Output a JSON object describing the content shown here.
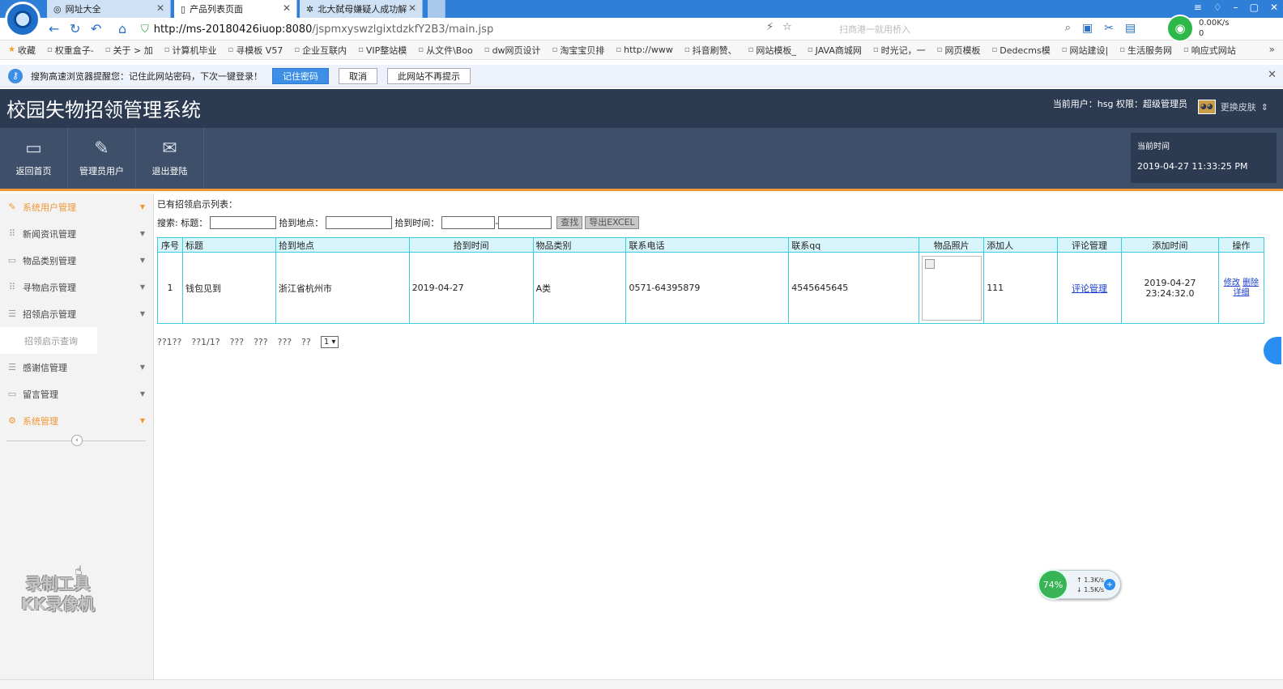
{
  "browser": {
    "tabs": [
      {
        "label": "网址大全",
        "active": false
      },
      {
        "label": "产品列表页面",
        "active": true
      },
      {
        "label": "北大弑母嫌疑人成功解",
        "active": false
      }
    ],
    "url_host": "http://ms-20180426iuop:8080",
    "url_path": "/jspmxyswzlgixtdzkfY2B3/main.jsp",
    "search_placeholder": "扫商港一就用桥入",
    "net_speed_down": "0.00K/s",
    "net_speed_up": "0",
    "bookmarks": [
      "收藏",
      "权重盒子-",
      "关于 > 加",
      "计算机毕业",
      "寻模板 V57",
      "企业互联内",
      "VIP整站模",
      "从文件\\Boo",
      "dw网页设计",
      "淘宝宝贝排",
      "http://www",
      "抖音刷赞、",
      "网站模板_",
      "JAVA商城网",
      "时光记，一",
      "网页模板",
      "Dedecms模",
      "网站建设|",
      "生活服务网",
      "响应式网站"
    ]
  },
  "password_bar": {
    "message": "搜狗高速浏览器提醒您：记住此网站密码，下次一键登录！",
    "remember": "记住密码",
    "cancel": "取消",
    "never": "此网站不再提示"
  },
  "header": {
    "title": "校园失物招领管理系统",
    "user_info": "当前用户：hsg 权限：超级管理员",
    "skin_label": "更换皮肤",
    "nav": [
      {
        "label": "返回首页",
        "icon": "monitor-icon"
      },
      {
        "label": "管理员用户",
        "icon": "pencil-icon"
      },
      {
        "label": "退出登陆",
        "icon": "envelope-icon"
      }
    ],
    "time_label": "当前时间",
    "time_value": "2019-04-27 11:33:25 PM"
  },
  "sidebar": {
    "items": [
      {
        "label": "系统用户管理",
        "icon": "pencil-icon",
        "highlight": true
      },
      {
        "label": "新闻资讯管理",
        "icon": "grid-icon",
        "highlight": false
      },
      {
        "label": "物品类别管理",
        "icon": "card-icon",
        "highlight": false
      },
      {
        "label": "寻物启示管理",
        "icon": "grid-icon",
        "highlight": false
      },
      {
        "label": "招领启示管理",
        "icon": "list-icon",
        "highlight": false
      }
    ],
    "sub_item": "招领启示查询",
    "items2": [
      {
        "label": "感谢信管理",
        "icon": "list-icon",
        "highlight": false
      },
      {
        "label": "留言管理",
        "icon": "card-icon",
        "highlight": false
      },
      {
        "label": "系统管理",
        "icon": "gear-icon",
        "highlight": true
      }
    ],
    "watermark_line1": "录制工具",
    "watermark_line2": "KK录像机"
  },
  "main": {
    "list_title": "已有招领启示列表：",
    "search": {
      "prefix": "搜索:",
      "title_label": "标题：",
      "place_label": "拾到地点：",
      "time_label": "拾到时间：",
      "dash": "-",
      "find_button": "查找",
      "export_button": "导出EXCEL"
    },
    "columns": [
      "序号",
      "标题",
      "拾到地点",
      "拾到时间",
      "物品类别",
      "联系电话",
      "联系qq",
      "物品照片",
      "添加人",
      "评论管理",
      "添加时间",
      "操作"
    ],
    "rows": [
      {
        "index": "1",
        "title": "钱包见到",
        "place": "浙江省杭州市",
        "time": "2019-04-27",
        "category": "A类",
        "phone": "0571-64395879",
        "qq": "4545645645",
        "adder": "111",
        "comment_link": "评论管理",
        "added_time": "2019-04-27 23:24:32.0",
        "action_edit": "修改",
        "action_delete": "删除",
        "action_detail": "详细"
      }
    ],
    "pager": {
      "items": [
        "??1??",
        "??1/1?",
        "???",
        "???",
        "???",
        "??"
      ],
      "select_value": "1 ▾"
    }
  },
  "netmon": {
    "percent": "74%",
    "up": "↑ 1.3K/s",
    "down": "↓ 1.5K/s"
  }
}
